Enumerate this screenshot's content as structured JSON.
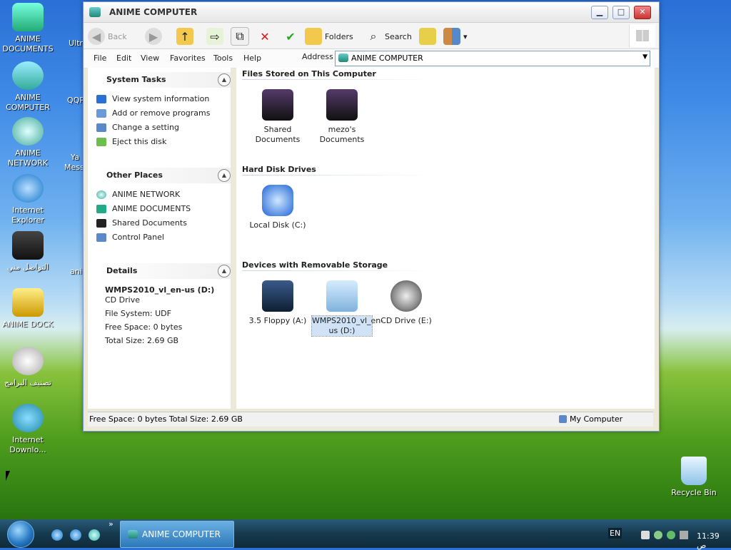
{
  "desktop": {
    "icons": [
      {
        "label": "ANIME DOCUMENTS"
      },
      {
        "label": "ANIME COMPUTER"
      },
      {
        "label": "ANIME NETWORK"
      },
      {
        "label": "Internet Explorer"
      },
      {
        "label": "التواصل مني"
      },
      {
        "label": "ANIME DOCK"
      },
      {
        "label": "تصنيف البرامج"
      },
      {
        "label": "Internet Downlo..."
      }
    ],
    "partial": [
      "Ultra",
      "QQP",
      "Ya",
      "Messe",
      "ani"
    ],
    "recycle_bin": "Recycle Bin"
  },
  "window": {
    "title": "ANIME COMPUTER",
    "controls": {
      "minimize": "▁",
      "maximize": "□",
      "close": "✕"
    },
    "toolbar": {
      "back": "Back",
      "folders": "Folders",
      "search": "Search"
    },
    "menu": [
      "File",
      "Edit",
      "View",
      "Favorites",
      "Tools",
      "Help"
    ],
    "address_label": "Address",
    "address_value": "ANIME COMPUTER"
  },
  "left_pane": {
    "system_tasks": {
      "title": "System Tasks",
      "items": [
        "View system information",
        "Add or remove programs",
        "Change a setting",
        "Eject this disk"
      ]
    },
    "other_places": {
      "title": "Other Places",
      "items": [
        "ANIME NETWORK",
        "ANIME DOCUMENTS",
        "Shared Documents",
        "Control Panel"
      ]
    },
    "details": {
      "title": "Details",
      "name": "WMPS2010_vl_en-us (D:)",
      "type": "CD Drive",
      "file_system": "File System: UDF",
      "free_space": "Free Space: 0 bytes",
      "total_size": "Total Size: 2.69 GB"
    }
  },
  "content": {
    "groups": [
      {
        "title": "Files Stored on This Computer",
        "items": [
          "Shared Documents",
          "mezo's Documents"
        ]
      },
      {
        "title": "Hard Disk Drives",
        "items": [
          "Local Disk (C:)"
        ]
      },
      {
        "title": "Devices with Removable Storage",
        "items": [
          "3.5 Floppy (A:)",
          "WMPS2010_vl_en-us (D:)",
          "CD Drive (E:)"
        ]
      }
    ]
  },
  "statusbar": {
    "left": "Free Space: 0 bytes Total Size: 2.69 GB",
    "right": "My Computer"
  },
  "taskbar": {
    "window_button": "ANIME COMPUTER",
    "chevron": "»",
    "language": "EN",
    "clock": "11:39 ص"
  },
  "colors": {
    "selection": "#cfe2f6",
    "title_text": "#333333",
    "taskbar": "#163a4f"
  }
}
